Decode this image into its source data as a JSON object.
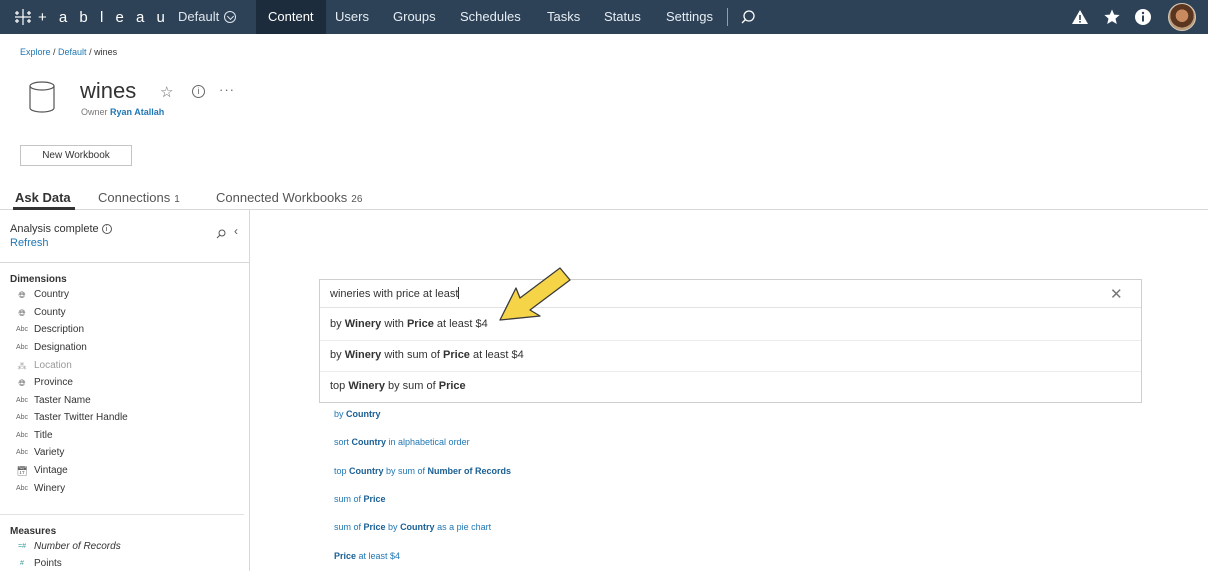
{
  "nav": {
    "logo_text": "+ a b l e a u",
    "site": "Default",
    "links": [
      "Content",
      "Users",
      "Groups",
      "Schedules",
      "Tasks",
      "Status",
      "Settings"
    ],
    "active": "Content"
  },
  "header": {
    "breadcrumb": {
      "explore": "Explore",
      "sep1": " / ",
      "default": "Default",
      "sep2": " / ",
      "current": "wines"
    },
    "title": "wines",
    "owner_label": "Owner",
    "owner_name": "Ryan Atallah",
    "new_workbook": "New Workbook"
  },
  "tabs": [
    {
      "label": "Ask Data",
      "count": ""
    },
    {
      "label": "Connections",
      "count": "1"
    },
    {
      "label": "Connected Workbooks",
      "count": "26"
    }
  ],
  "left": {
    "analysis": "Analysis complete",
    "refresh": "Refresh",
    "dimensions_title": "Dimensions",
    "dimensions": [
      {
        "type": "globe",
        "name": "Country"
      },
      {
        "type": "globe",
        "name": "County"
      },
      {
        "type": "Abc",
        "name": "Description"
      },
      {
        "type": "Abc",
        "name": "Designation"
      },
      {
        "type": "geo",
        "name": "Location"
      },
      {
        "type": "globe",
        "name": "Province"
      },
      {
        "type": "Abc",
        "name": "Taster Name"
      },
      {
        "type": "Abc",
        "name": "Taster Twitter Handle"
      },
      {
        "type": "Abc",
        "name": "Title"
      },
      {
        "type": "Abc",
        "name": "Variety"
      },
      {
        "type": "calendar",
        "name": "Vintage"
      },
      {
        "type": "Abc",
        "name": "Winery"
      }
    ],
    "measures_title": "Measures",
    "measures": [
      {
        "type": "=#",
        "name": "Number of Records"
      },
      {
        "type": "#",
        "name": "Points"
      }
    ]
  },
  "ask": {
    "query": "wineries with price at least",
    "suggestions": [
      {
        "p1": "by ",
        "b1": "Winery",
        "p2": " with ",
        "b2": "Price",
        "p3": " at least $4"
      },
      {
        "p1": "by ",
        "b1": "Winery",
        "p2": " with sum of ",
        "b2": "Price",
        "p3": " at least $4"
      },
      {
        "p1": "top ",
        "b1": "Winery",
        "p2": " by sum of ",
        "b2": "Price",
        "p3": ""
      }
    ],
    "recommendations": [
      {
        "p1": "by ",
        "b1": "Country",
        "p2": "",
        "b2": "",
        "p3": ""
      },
      {
        "p1": "sort ",
        "b1": "Country",
        "p2": " in alphabetical order",
        "b2": "",
        "p3": ""
      },
      {
        "p1": "top ",
        "b1": "Country",
        "p2": " by sum of ",
        "b2": "Number of Records",
        "p3": ""
      },
      {
        "p1": "sum of ",
        "b1": "Price",
        "p2": "",
        "b2": "",
        "p3": ""
      },
      {
        "p1": "sum of ",
        "b1": "Price",
        "p2": " by ",
        "b2": "Country",
        "p3": " as a pie chart"
      },
      {
        "p1": "",
        "b1": "Price",
        "p2": " at least $4",
        "b2": "",
        "p3": ""
      }
    ]
  },
  "colors": {
    "nav_bg": "#2e4257",
    "link": "#1f77b4",
    "arrow": "#f5d547"
  }
}
